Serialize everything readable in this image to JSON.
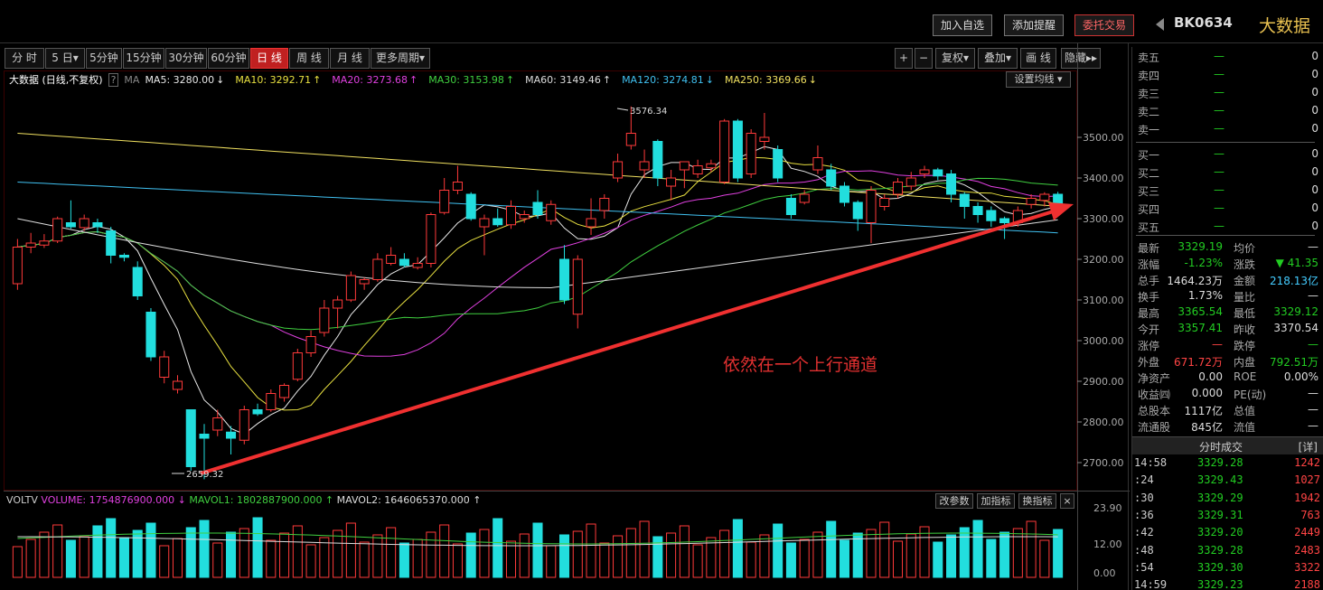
{
  "topbar": {
    "add_watch": "加入自选",
    "add_alert": "添加提醒",
    "trade": "委托交易",
    "code": "BK0634",
    "name": "大数据"
  },
  "periods": [
    "分 时",
    "5 日▾",
    "5分钟",
    "15分钟",
    "30分钟",
    "60分钟",
    "日 线",
    "周 线",
    "月 线",
    "更多周期▾"
  ],
  "active_period": "日 线",
  "right_tools": [
    "+",
    "−",
    "复权▾",
    "叠加▾",
    "画 线",
    "隐藏▸▸"
  ],
  "ma_legend": {
    "title": "大数据 (日线,不复权)",
    "help": "?",
    "ma": "MA",
    "items": [
      {
        "text": "MA5: 3280.00",
        "arrow": "↓",
        "color": "#e8e8e8"
      },
      {
        "text": "MA10: 3292.71",
        "arrow": "↑",
        "color": "#e8e040"
      },
      {
        "text": "MA20: 3273.68",
        "arrow": "↑",
        "color": "#e040e0"
      },
      {
        "text": "MA30: 3153.98",
        "arrow": "↑",
        "color": "#40d040"
      },
      {
        "text": "MA60: 3149.46",
        "arrow": "↑",
        "color": "#dddddd"
      },
      {
        "text": "MA120: 3274.81",
        "arrow": "↓",
        "color": "#40c0f0"
      },
      {
        "text": "MA250: 3369.66",
        "arrow": "↓",
        "color": "#f0e060"
      }
    ],
    "set_button": "设置均线 ▾"
  },
  "chart_data": {
    "type": "candlestick",
    "y_ticks": [
      "3500.00",
      "3400.00",
      "3300.00",
      "3200.00",
      "3100.00",
      "3000.00",
      "2900.00",
      "2800.00",
      "2700.00"
    ],
    "high_label": "3576.34",
    "low_label": "2659.32",
    "annotation": "依然在一个上行通道",
    "candles": [
      {
        "o": 3140,
        "c": 3230,
        "h": 3250,
        "l": 3125
      },
      {
        "o": 3230,
        "c": 3240,
        "h": 3265,
        "l": 3215
      },
      {
        "o": 3235,
        "c": 3245,
        "h": 3262,
        "l": 3228
      },
      {
        "o": 3245,
        "c": 3300,
        "h": 3305,
        "l": 3240
      },
      {
        "o": 3290,
        "c": 3280,
        "h": 3345,
        "l": 3275
      },
      {
        "o": 3278,
        "c": 3300,
        "h": 3310,
        "l": 3270
      },
      {
        "o": 3290,
        "c": 3280,
        "h": 3300,
        "l": 3265
      },
      {
        "o": 3270,
        "c": 3210,
        "h": 3280,
        "l": 3190
      },
      {
        "o": 3210,
        "c": 3205,
        "h": 3215,
        "l": 3195
      },
      {
        "o": 3180,
        "c": 3110,
        "h": 3195,
        "l": 3100
      },
      {
        "o": 3070,
        "c": 2960,
        "h": 3080,
        "l": 2950
      },
      {
        "o": 2910,
        "c": 2960,
        "h": 2975,
        "l": 2895
      },
      {
        "o": 2880,
        "c": 2900,
        "h": 2915,
        "l": 2870
      },
      {
        "o": 2830,
        "c": 2690,
        "h": 2830,
        "l": 2680
      },
      {
        "o": 2770,
        "c": 2760,
        "h": 2795,
        "l": 2659
      },
      {
        "o": 2780,
        "c": 2810,
        "h": 2830,
        "l": 2765
      },
      {
        "o": 2775,
        "c": 2760,
        "h": 2790,
        "l": 2720
      },
      {
        "o": 2755,
        "c": 2830,
        "h": 2840,
        "l": 2745
      },
      {
        "o": 2830,
        "c": 2820,
        "h": 2845,
        "l": 2815
      },
      {
        "o": 2830,
        "c": 2870,
        "h": 2880,
        "l": 2825
      },
      {
        "o": 2860,
        "c": 2890,
        "h": 2895,
        "l": 2850
      },
      {
        "o": 2905,
        "c": 2970,
        "h": 2980,
        "l": 2900
      },
      {
        "o": 2970,
        "c": 3010,
        "h": 3025,
        "l": 2960
      },
      {
        "o": 3020,
        "c": 3080,
        "h": 3100,
        "l": 3010
      },
      {
        "o": 3080,
        "c": 3100,
        "h": 3110,
        "l": 3030
      },
      {
        "o": 3100,
        "c": 3160,
        "h": 3170,
        "l": 3095
      },
      {
        "o": 3140,
        "c": 3150,
        "h": 3155,
        "l": 3125
      },
      {
        "o": 3150,
        "c": 3200,
        "h": 3215,
        "l": 3145
      },
      {
        "o": 3190,
        "c": 3210,
        "h": 3230,
        "l": 3185
      },
      {
        "o": 3200,
        "c": 3185,
        "h": 3215,
        "l": 3180
      },
      {
        "o": 3180,
        "c": 3190,
        "h": 3205,
        "l": 3175
      },
      {
        "o": 3190,
        "c": 3310,
        "h": 3315,
        "l": 3180
      },
      {
        "o": 3315,
        "c": 3370,
        "h": 3400,
        "l": 3310
      },
      {
        "o": 3370,
        "c": 3390,
        "h": 3430,
        "l": 3360
      },
      {
        "o": 3360,
        "c": 3300,
        "h": 3365,
        "l": 3295
      },
      {
        "o": 3280,
        "c": 3300,
        "h": 3310,
        "l": 3210
      },
      {
        "o": 3300,
        "c": 3285,
        "h": 3325,
        "l": 3280
      },
      {
        "o": 3285,
        "c": 3330,
        "h": 3345,
        "l": 3275
      },
      {
        "o": 3300,
        "c": 3310,
        "h": 3320,
        "l": 3290
      },
      {
        "o": 3340,
        "c": 3310,
        "h": 3370,
        "l": 3300
      },
      {
        "o": 3295,
        "c": 3335,
        "h": 3345,
        "l": 3285
      },
      {
        "o": 3200,
        "c": 3100,
        "h": 3235,
        "l": 3090
      },
      {
        "o": 3065,
        "c": 3200,
        "h": 3210,
        "l": 3030
      },
      {
        "o": 3280,
        "c": 3300,
        "h": 3350,
        "l": 3260
      },
      {
        "o": 3320,
        "c": 3350,
        "h": 3360,
        "l": 3300
      },
      {
        "o": 3400,
        "c": 3440,
        "h": 3460,
        "l": 3390
      },
      {
        "o": 3480,
        "c": 3510,
        "h": 3576,
        "l": 3470
      },
      {
        "o": 3420,
        "c": 3440,
        "h": 3470,
        "l": 3400
      },
      {
        "o": 3490,
        "c": 3400,
        "h": 3495,
        "l": 3380
      },
      {
        "o": 3380,
        "c": 3400,
        "h": 3420,
        "l": 3345
      },
      {
        "o": 3420,
        "c": 3440,
        "h": 3440,
        "l": 3375
      },
      {
        "o": 3410,
        "c": 3430,
        "h": 3445,
        "l": 3400
      },
      {
        "o": 3425,
        "c": 3435,
        "h": 3445,
        "l": 3415
      },
      {
        "o": 3390,
        "c": 3540,
        "h": 3545,
        "l": 3385
      },
      {
        "o": 3540,
        "c": 3400,
        "h": 3545,
        "l": 3390
      },
      {
        "o": 3410,
        "c": 3510,
        "h": 3520,
        "l": 3400
      },
      {
        "o": 3490,
        "c": 3500,
        "h": 3560,
        "l": 3470
      },
      {
        "o": 3470,
        "c": 3400,
        "h": 3480,
        "l": 3390
      },
      {
        "o": 3350,
        "c": 3310,
        "h": 3360,
        "l": 3300
      },
      {
        "o": 3340,
        "c": 3360,
        "h": 3370,
        "l": 3335
      },
      {
        "o": 3420,
        "c": 3450,
        "h": 3480,
        "l": 3410
      },
      {
        "o": 3420,
        "c": 3380,
        "h": 3435,
        "l": 3370
      },
      {
        "o": 3380,
        "c": 3340,
        "h": 3390,
        "l": 3330
      },
      {
        "o": 3340,
        "c": 3300,
        "h": 3345,
        "l": 3270
      },
      {
        "o": 3290,
        "c": 3370,
        "h": 3380,
        "l": 3240
      },
      {
        "o": 3330,
        "c": 3350,
        "h": 3360,
        "l": 3320
      },
      {
        "o": 3360,
        "c": 3390,
        "h": 3400,
        "l": 3350
      },
      {
        "o": 3380,
        "c": 3400,
        "h": 3415,
        "l": 3370
      },
      {
        "o": 3410,
        "c": 3420,
        "h": 3430,
        "l": 3400
      },
      {
        "o": 3420,
        "c": 3405,
        "h": 3425,
        "l": 3395
      },
      {
        "o": 3410,
        "c": 3360,
        "h": 3420,
        "l": 3340
      },
      {
        "o": 3360,
        "c": 3330,
        "h": 3365,
        "l": 3300
      },
      {
        "o": 3330,
        "c": 3310,
        "h": 3340,
        "l": 3290
      },
      {
        "o": 3320,
        "c": 3295,
        "h": 3330,
        "l": 3280
      },
      {
        "o": 3300,
        "c": 3290,
        "h": 3305,
        "l": 3250
      },
      {
        "o": 3290,
        "c": 3320,
        "h": 3330,
        "l": 3280
      },
      {
        "o": 3335,
        "c": 3350,
        "h": 3360,
        "l": 3325
      },
      {
        "o": 3345,
        "c": 3360,
        "h": 3365,
        "l": 3330
      },
      {
        "o": 3360,
        "c": 3330,
        "h": 3366,
        "l": 3329
      }
    ]
  },
  "volume": {
    "label": "VOLTV",
    "volume": "VOLUME: 1754876900.000 ↓",
    "mavol1": "MAVOL1: 1802887900.000 ↑",
    "mavol2": "MAVOL2: 1646065370.000 ↑",
    "y_ticks": [
      "23.90",
      "12.00",
      "0.00"
    ],
    "buttons": [
      "改参数",
      "加指标",
      "换指标"
    ],
    "close": "×"
  },
  "orderbook": {
    "asks": [
      {
        "label": "卖五",
        "price": "—",
        "vol": "0"
      },
      {
        "label": "卖四",
        "price": "—",
        "vol": "0"
      },
      {
        "label": "卖三",
        "price": "—",
        "vol": "0"
      },
      {
        "label": "卖二",
        "price": "—",
        "vol": "0"
      },
      {
        "label": "卖一",
        "price": "—",
        "vol": "0"
      }
    ],
    "bids": [
      {
        "label": "买一",
        "price": "—",
        "vol": "0"
      },
      {
        "label": "买二",
        "price": "—",
        "vol": "0"
      },
      {
        "label": "买三",
        "price": "—",
        "vol": "0"
      },
      {
        "label": "买四",
        "price": "—",
        "vol": "0"
      },
      {
        "label": "买五",
        "price": "—",
        "vol": "0"
      }
    ]
  },
  "quote": [
    {
      "l1": "最新",
      "v1": "3329.19",
      "c1": "#2c2",
      "l2": "均价",
      "v2": "—",
      "c2": "#ddd"
    },
    {
      "l1": "涨幅",
      "v1": "-1.23%",
      "c1": "#2c2",
      "l2": "涨跌",
      "v2": "▼ 41.35",
      "c2": "#2c2"
    },
    {
      "l1": "总手",
      "v1": "1464.23万",
      "c1": "#ddd",
      "l2": "金额",
      "v2": "218.13亿",
      "c2": "#4cf"
    },
    {
      "l1": "换手",
      "v1": "1.73%",
      "c1": "#ddd",
      "l2": "量比",
      "v2": "—",
      "c2": "#ddd"
    },
    {
      "l1": "最高",
      "v1": "3365.54",
      "c1": "#2c2",
      "l2": "最低",
      "v2": "3329.12",
      "c2": "#2c2"
    },
    {
      "l1": "今开",
      "v1": "3357.41",
      "c1": "#2c2",
      "l2": "昨收",
      "v2": "3370.54",
      "c2": "#ddd"
    },
    {
      "l1": "涨停",
      "v1": "—",
      "c1": "#f44",
      "l2": "跌停",
      "v2": "—",
      "c2": "#2c2"
    },
    {
      "l1": "外盘",
      "v1": "671.72万",
      "c1": "#f44",
      "l2": "内盘",
      "v2": "792.51万",
      "c2": "#2c2"
    },
    {
      "l1": "净资产",
      "v1": "0.00",
      "c1": "#ddd",
      "l2": "ROE",
      "v2": "0.00%",
      "c2": "#ddd"
    },
    {
      "l1": "收益㈣",
      "v1": "0.000",
      "c1": "#ddd",
      "l2": "PE(动)",
      "v2": "—",
      "c2": "#ddd"
    },
    {
      "l1": "总股本",
      "v1": "1117亿",
      "c1": "#ddd",
      "l2": "总值",
      "v2": "—",
      "c2": "#ddd"
    },
    {
      "l1": "流通股",
      "v1": "845亿",
      "c1": "#ddd",
      "l2": "流值",
      "v2": "—",
      "c2": "#ddd"
    }
  ],
  "ticks_header": "分时成交",
  "ticks_detail": "[详]",
  "ticks": [
    {
      "t": "14:58",
      "p": "3329.28",
      "v": "1242"
    },
    {
      "t": "  :24",
      "p": "3329.43",
      "v": "1027"
    },
    {
      "t": "  :30",
      "p": "3329.29",
      "v": "1942"
    },
    {
      "t": "  :36",
      "p": "3329.31",
      "v": "763"
    },
    {
      "t": "  :42",
      "p": "3329.20",
      "v": "2449"
    },
    {
      "t": "  :48",
      "p": "3329.28",
      "v": "2483"
    },
    {
      "t": "  :54",
      "p": "3329.30",
      "v": "3322"
    },
    {
      "t": "14:59",
      "p": "3329.23",
      "v": "2188"
    }
  ]
}
